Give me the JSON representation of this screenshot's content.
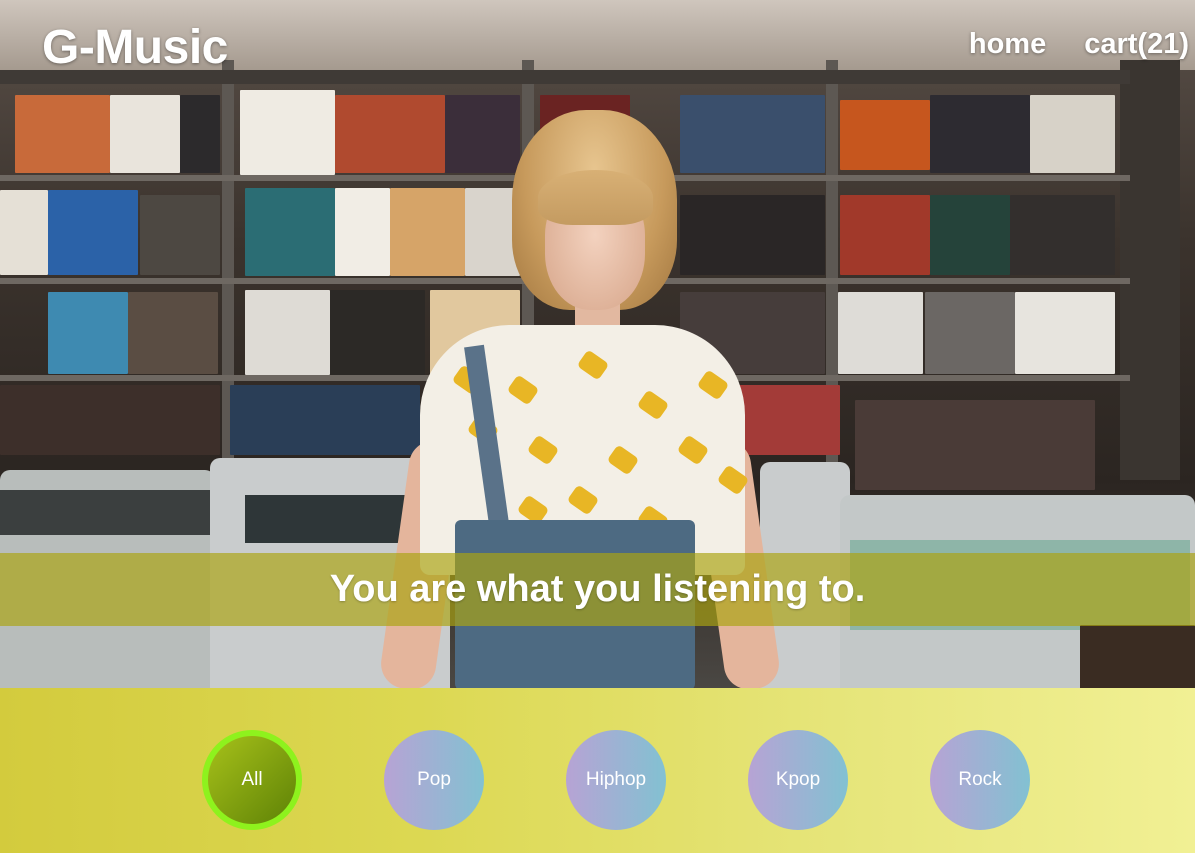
{
  "header": {
    "logo": "G-Music",
    "nav": [
      {
        "label": "home"
      },
      {
        "label": "cart(21)"
      }
    ]
  },
  "hero": {
    "tagline": "You are what you listening to."
  },
  "genres": {
    "active": "All",
    "items": [
      {
        "label": "All"
      },
      {
        "label": "Pop"
      },
      {
        "label": "Hiphop"
      },
      {
        "label": "Kpop"
      },
      {
        "label": "Rock"
      }
    ]
  }
}
